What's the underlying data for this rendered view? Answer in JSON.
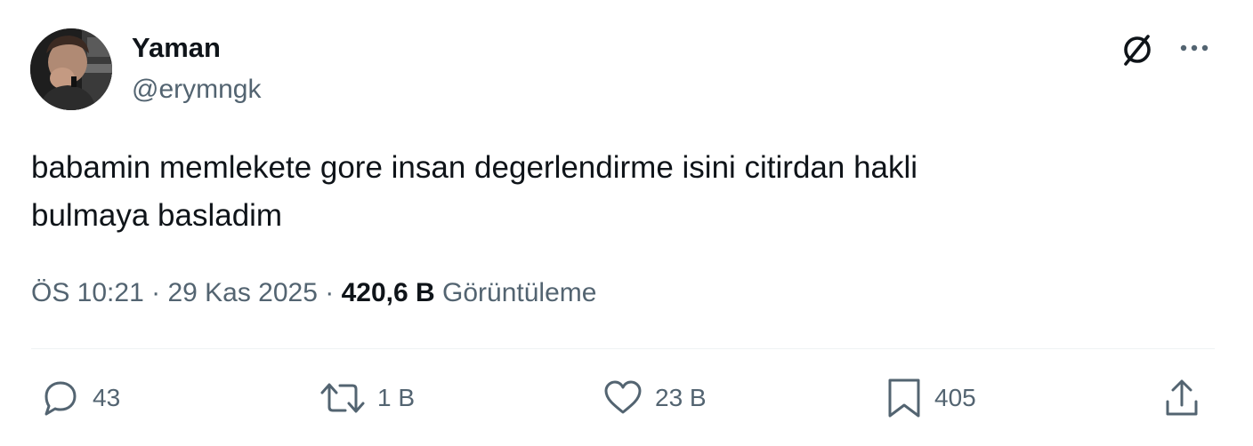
{
  "author": {
    "display_name": "Yaman",
    "handle": "@erymngk"
  },
  "tweet": {
    "text_line1": "babamin memlekete gore insan degerlendirme isini citirdan hakli",
    "text_line2": "bulmaya basladim"
  },
  "meta": {
    "time": "ÖS 10:21",
    "separator": " · ",
    "date": "29 Kas 2025",
    "views_count": "420,6 B",
    "views_label": "Görüntüleme"
  },
  "actions": {
    "replies": "43",
    "reposts": "1 B",
    "likes": "23 B",
    "bookmarks": "405"
  },
  "icons": {
    "header": [
      "grok-icon",
      "more-icon"
    ],
    "actions": [
      "reply-icon",
      "repost-icon",
      "like-icon",
      "bookmark-icon",
      "share-icon"
    ]
  },
  "colors": {
    "text_primary": "#0f1419",
    "text_secondary": "#536471",
    "divider": "#eff3f4"
  }
}
